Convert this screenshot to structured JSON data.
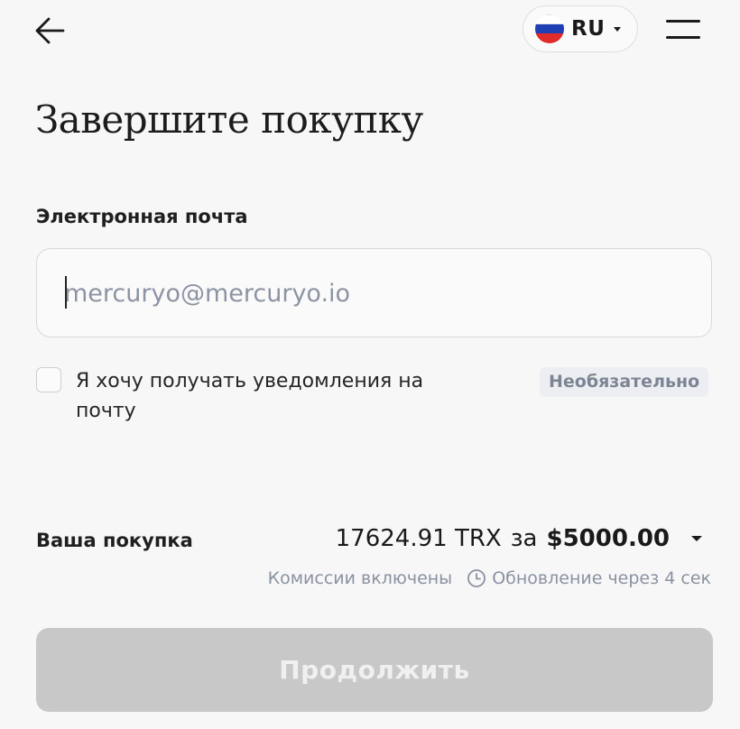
{
  "header": {
    "back_icon": "arrow-left-icon",
    "language": {
      "code": "RU",
      "flag_icon": "russia-flag-icon",
      "dropdown_icon": "caret-down-icon"
    },
    "menu_icon": "hamburger-menu-icon"
  },
  "page": {
    "title": "Завершите покупку"
  },
  "email": {
    "label": "Электронная почта",
    "value": "",
    "placeholder": "mercuryo@mercuryo.io"
  },
  "notifications": {
    "checked": false,
    "label": "Я хочу получать уведомления на почту",
    "optional_badge": "Необязательно"
  },
  "purchase": {
    "label": "Ваша покупка",
    "crypto_amount": "17624.91 TRX",
    "connector": "за",
    "fiat_amount": "$5000.00",
    "fees_note": "Комиссии включены",
    "refresh_icon": "clock-icon",
    "refresh_note": "Обновление через 4 сек"
  },
  "actions": {
    "continue_label": "Продолжить"
  },
  "colors": {
    "background": "#f7f7f8",
    "button_disabled": "#c8c8c8",
    "muted_text": "#8a92a0",
    "flag_blue": "#1f3fb4",
    "flag_red": "#e12a2a"
  }
}
